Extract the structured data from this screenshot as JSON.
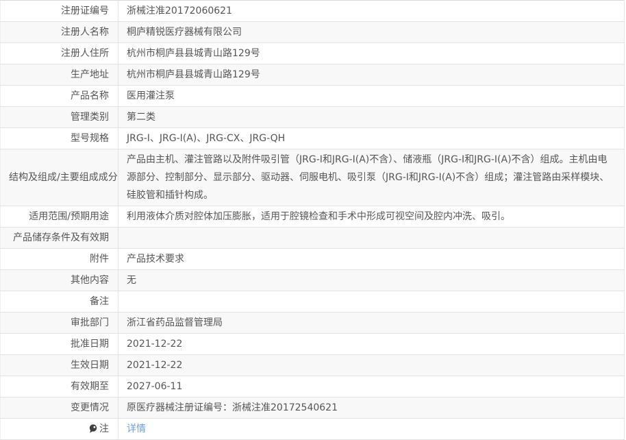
{
  "table": {
    "colors": {
      "row_alt_bg": "#f8f8f8",
      "border": "#e2e2e2",
      "text": "#555555",
      "link": "#6b9fdc"
    },
    "rows": [
      {
        "label": "注册证编号",
        "value": "浙械注准20172060621"
      },
      {
        "label": "注册人名称",
        "value": "桐庐精锐医疗器械有限公司"
      },
      {
        "label": "注册人住所",
        "value": "杭州市桐庐县县城青山路129号"
      },
      {
        "label": "生产地址",
        "value": "杭州市桐庐县县城青山路129号"
      },
      {
        "label": "产品名称",
        "value": "医用灌注泵"
      },
      {
        "label": "管理类别",
        "value": "第二类"
      },
      {
        "label": "型号规格",
        "value": "JRG-I、JRG-I(A)、JRG-CX、JRG-QH"
      },
      {
        "label": "结构及组成/主要组成成分",
        "value": "产品由主机、灌注管路以及附件吸引管（JRG-I和JRG-I(A)不含）、储液瓶（JRG-I和JRG-I(A)不含）组成。主机由电源部分、控制部分、显示部分、驱动器、伺服电机、吸引泵（JRG-I和JRG-I(A)不含）组成；灌注管路由采样模块、硅胶管和插针构成。"
      },
      {
        "label": "适用范围/预期用途",
        "value": "利用液体介质对腔体加压膨胀，适用于腔镜检查和手术中形成可视空间及腔内冲洗、吸引。"
      },
      {
        "label": "产品储存条件及有效期",
        "value": ""
      },
      {
        "label": "附件",
        "value": "产品技术要求"
      },
      {
        "label": "其他内容",
        "value": "无"
      },
      {
        "label": "备注",
        "value": ""
      },
      {
        "label": "审批部门",
        "value": "浙江省药品监督管理局"
      },
      {
        "label": "批准日期",
        "value": "2021-12-22"
      },
      {
        "label": "生效日期",
        "value": "2021-12-22"
      },
      {
        "label": "有效期至",
        "value": "2027-06-11"
      },
      {
        "label": "变更情况",
        "value": "原医疗器械注册证编号：浙械注准20172540621"
      },
      {
        "label": "注",
        "value": "详情",
        "value_is_link": true,
        "label_icon": "note-balloon-icon"
      }
    ]
  }
}
